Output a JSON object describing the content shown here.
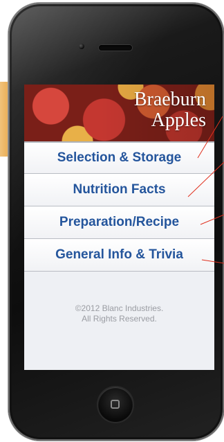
{
  "app": {
    "header": {
      "title_line1": "Braeburn",
      "title_line2": "Apples"
    },
    "menu": {
      "items": [
        {
          "label": "Selection & Storage"
        },
        {
          "label": "Nutrition Facts"
        },
        {
          "label": "Preparation/Recipe"
        },
        {
          "label": "General Info & Trivia"
        }
      ]
    },
    "footer": {
      "line1": "©2012 Blanc Industries.",
      "line2": "All Rights Reserved."
    }
  },
  "colors": {
    "menu_text": "#24559c",
    "leader_lines": "#e0301e",
    "side_tab": "#e7a84c",
    "phone_body": "#111111"
  },
  "icons": {
    "home_button": "home-button-icon",
    "camera": "camera-icon",
    "speaker": "speaker-grille-icon"
  }
}
